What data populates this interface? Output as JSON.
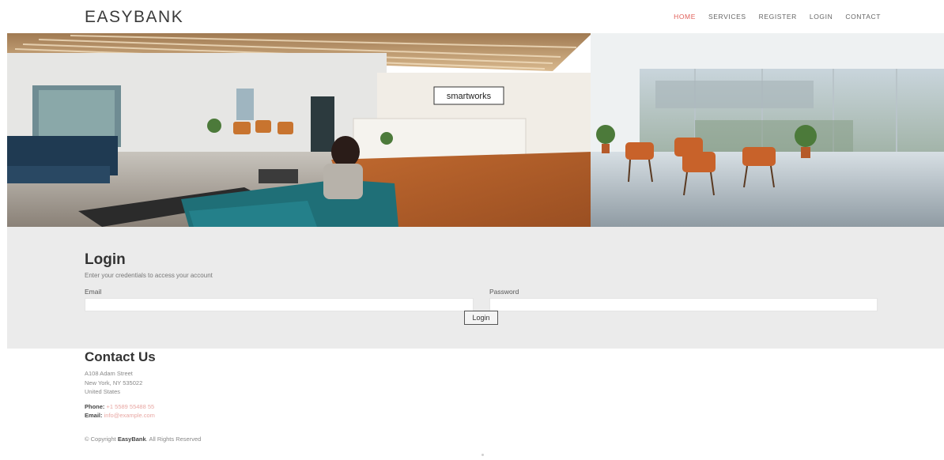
{
  "header": {
    "logo": "EASYBANK",
    "nav": [
      {
        "label": "HOME",
        "active": true
      },
      {
        "label": "SERVICES",
        "active": false
      },
      {
        "label": "REGISTER",
        "active": false
      },
      {
        "label": "LOGIN",
        "active": false
      },
      {
        "label": "CONTACT",
        "active": false
      }
    ]
  },
  "hero": {
    "sign_text": "smartworks"
  },
  "login": {
    "title": "Login",
    "subtitle": "Enter your credentials to access your account",
    "email_label": "Email",
    "email_value": "",
    "password_label": "Password",
    "password_value": "",
    "button_label": "Login"
  },
  "contact": {
    "title": "Contact Us",
    "address": [
      "A108 Adam Street",
      "New York, NY 535022",
      "United States"
    ],
    "phone_label": "Phone:",
    "phone_value": "+1 5589 55488 55",
    "email_label": "Email:",
    "email_value": "info@example.com"
  },
  "footer": {
    "copyright_prefix": "© Copyright",
    "copyright_brand": "EasyBank",
    "copyright_suffix": "All Rights Reserved"
  },
  "colors": {
    "accent": "#e0605a",
    "login_bg": "#ebebeb",
    "link": "#e8a7a3"
  }
}
